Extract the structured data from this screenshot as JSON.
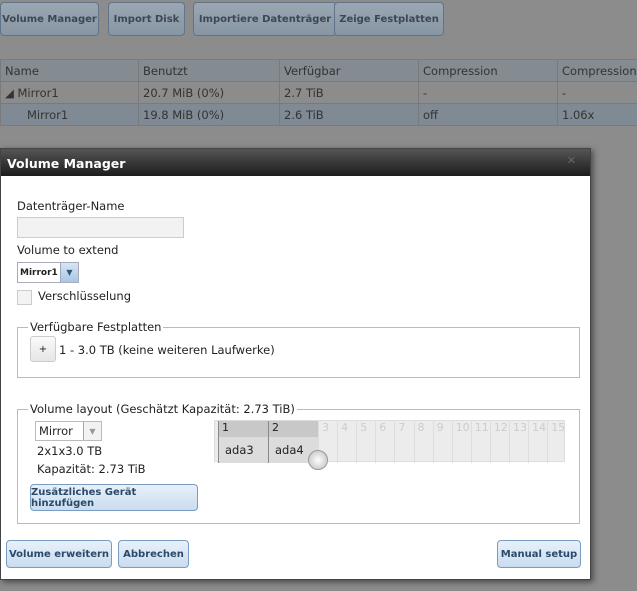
{
  "toolbar": {
    "buttons": [
      "Volume Manager",
      "Import Disk",
      "Importiere Datenträger",
      "Zeige Festplatten"
    ]
  },
  "table": {
    "headers": [
      "Name",
      "Benutzt",
      "Verfügbar",
      "Compression",
      "Compression"
    ],
    "rows": [
      [
        "◢ Mirror1",
        "20.7 MiB (0%)",
        "2.7 TiB",
        "-",
        "-"
      ],
      [
        "Mirror1",
        "19.8 MiB (0%)",
        "2.6 TiB",
        "off",
        "1.06x"
      ]
    ]
  },
  "dialog": {
    "title": "Volume Manager",
    "close": "✕",
    "name_label": "Datenträger-Name",
    "name_value": "",
    "extend_label": "Volume to extend",
    "extend_value": "Mirror1",
    "encryption_label": "Verschlüsselung",
    "disks_legend": "Verfügbare Festplatten",
    "add_disk": "+",
    "disks_text": "1 - 3.0 TB (keine weiteren Laufwerke)",
    "layout_legend": "Volume layout (Geschätzt Kapazität: 2.73 TiB)",
    "layout_value": "Mirror",
    "layout_desc": "2x1x3.0 TB",
    "capacity": "Kapazität: 2.73 TiB",
    "add_device": "Zusätzliches Gerät hinzufügen",
    "grid_cols": [
      "1",
      "2",
      "3",
      "4",
      "5",
      "6",
      "7",
      "8",
      "9",
      "10",
      "11",
      "12",
      "13",
      "14",
      "15"
    ],
    "grid_disks": [
      "ada3",
      "ada4"
    ],
    "extend_btn": "Volume erweitern",
    "cancel_btn": "Abbrechen",
    "manual_btn": "Manual setup"
  }
}
